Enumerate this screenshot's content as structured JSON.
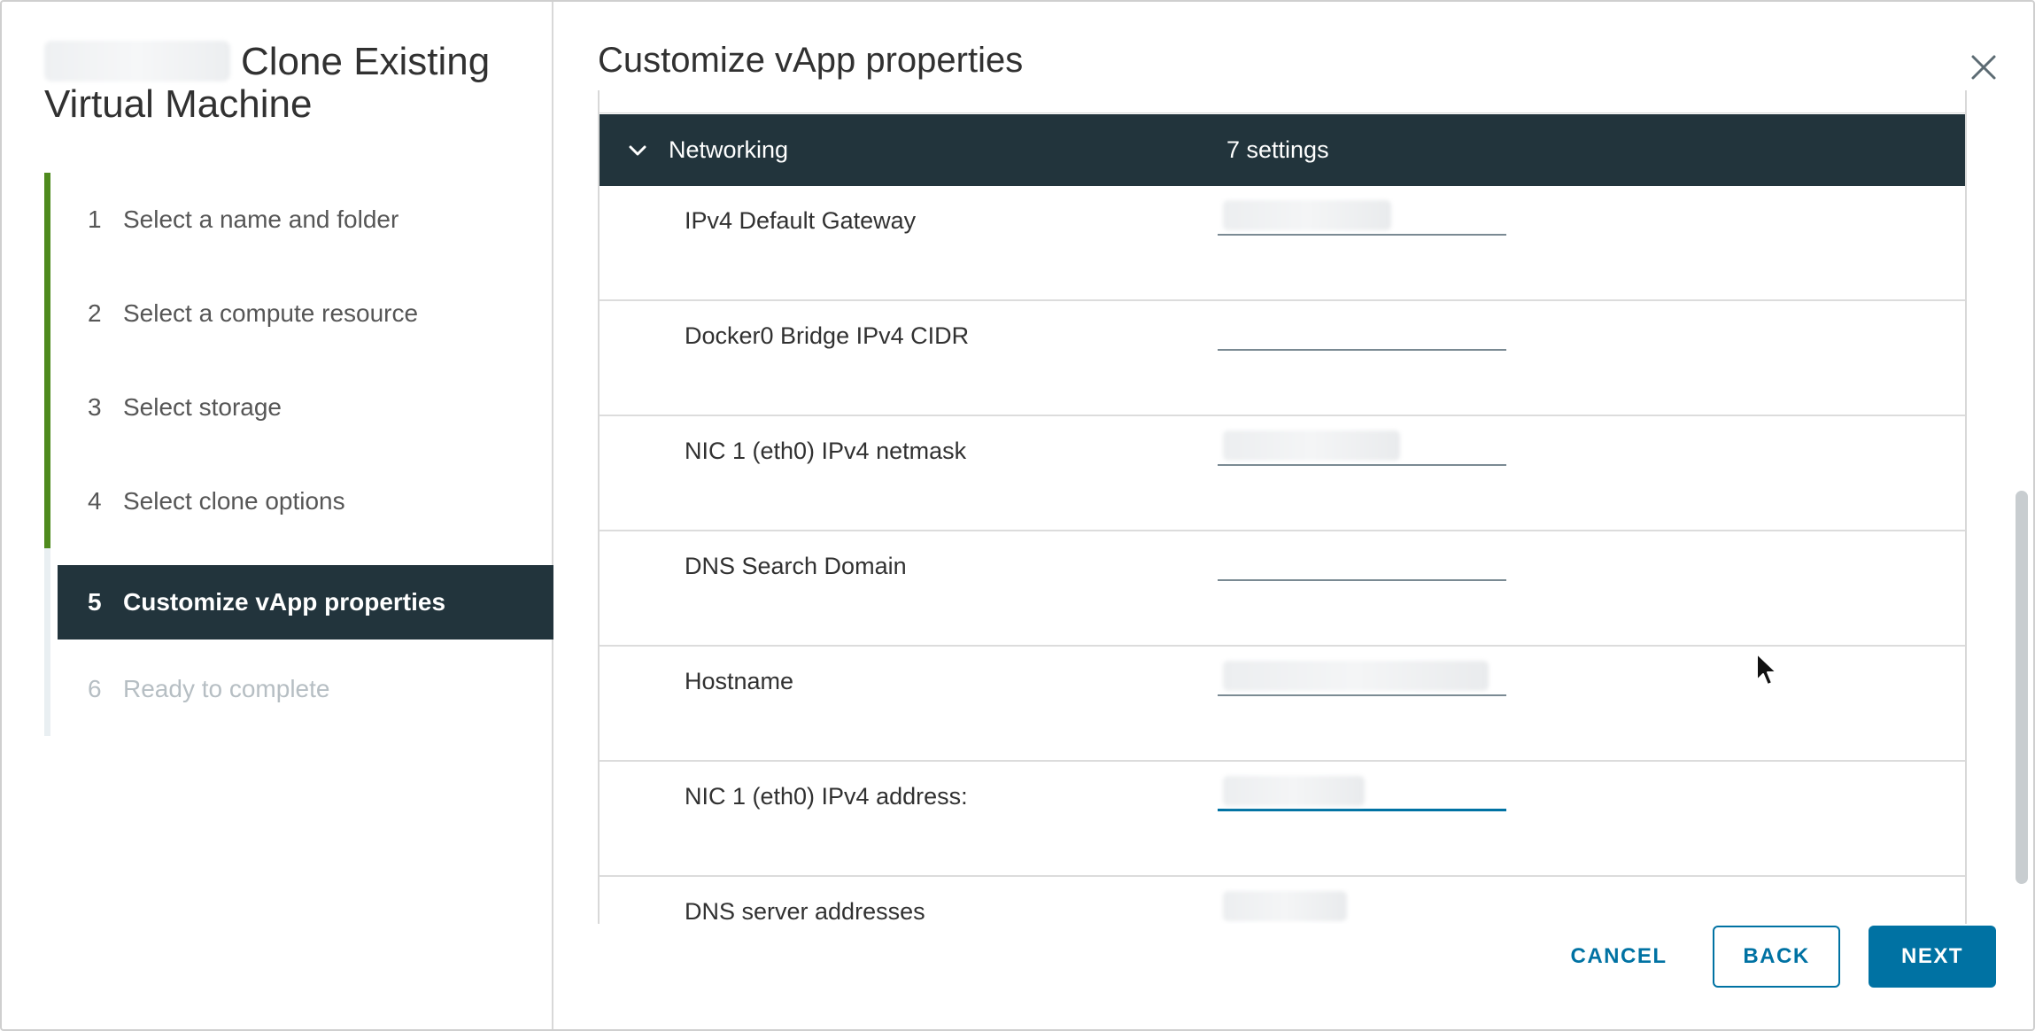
{
  "sidebar": {
    "title": "Clone Existing Virtual Machine",
    "steps": [
      {
        "num": "1",
        "label": "Select a name and folder"
      },
      {
        "num": "2",
        "label": "Select a compute resource"
      },
      {
        "num": "3",
        "label": "Select storage"
      },
      {
        "num": "4",
        "label": "Select clone options"
      },
      {
        "num": "5",
        "label": "Customize vApp properties"
      },
      {
        "num": "6",
        "label": "Ready to complete"
      }
    ]
  },
  "main": {
    "title": "Customize vApp properties",
    "group": {
      "name": "Networking",
      "count": "7 settings"
    },
    "properties": [
      {
        "label": "IPv4 Default Gateway"
      },
      {
        "label": "Docker0 Bridge IPv4 CIDR"
      },
      {
        "label": "NIC 1 (eth0) IPv4 netmask"
      },
      {
        "label": "DNS Search Domain"
      },
      {
        "label": "Hostname"
      },
      {
        "label": "NIC 1 (eth0) IPv4 address:"
      },
      {
        "label": "DNS server addresses"
      }
    ]
  },
  "footer": {
    "cancel": "CANCEL",
    "back": "BACK",
    "next": "NEXT"
  },
  "colors": {
    "accent": "#0072a3",
    "header_bg": "#22343c",
    "completed": "#4e8a1d"
  },
  "icons": {
    "close": "close-icon",
    "chevron": "chevron-down-icon",
    "cursor": "mouse-pointer-icon"
  }
}
